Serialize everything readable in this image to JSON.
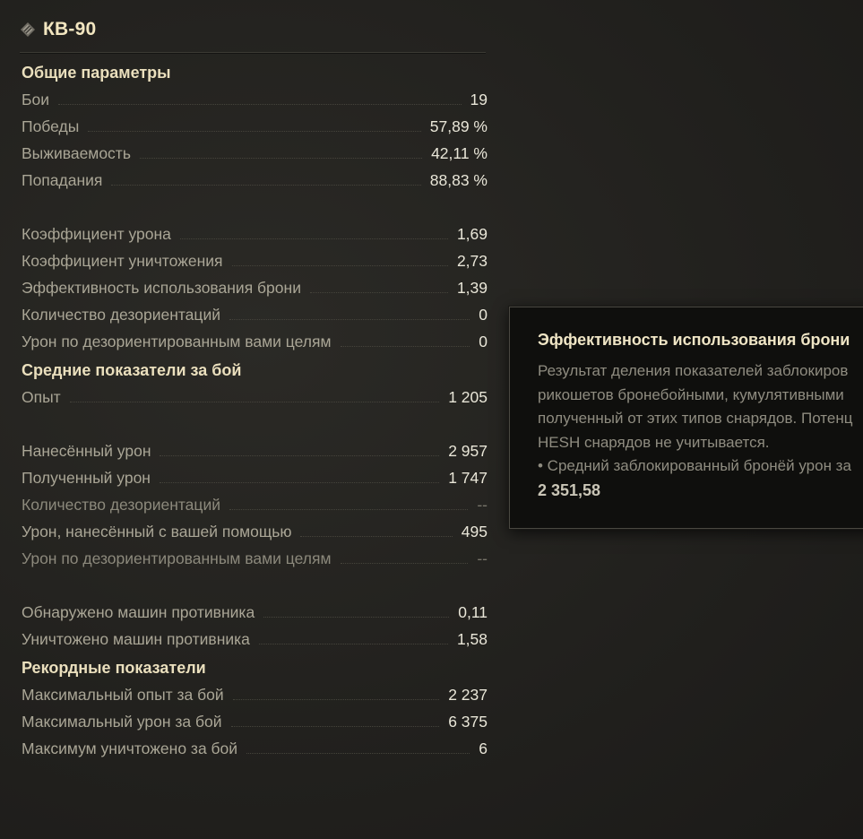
{
  "header": {
    "title": "КВ-90",
    "tier_icon": "heavy-tank-class-icon"
  },
  "sections": [
    {
      "title": "Общие параметры",
      "groups": [
        [
          {
            "label": "Бои",
            "value": "19"
          },
          {
            "label": "Победы",
            "value": "57,89 %"
          },
          {
            "label": "Выживаемость",
            "value": "42,11 %"
          },
          {
            "label": "Попадания",
            "value": "88,83 %"
          }
        ],
        [
          {
            "label": "Коэффициент урона",
            "value": "1,69"
          },
          {
            "label": "Коэффициент уничтожения",
            "value": "2,73"
          },
          {
            "label": "Эффективность использования брони",
            "value": "1,39"
          },
          {
            "label": "Количество дезориентаций",
            "value": "0"
          },
          {
            "label": "Урон по дезориентированным вами целям",
            "value": "0"
          }
        ]
      ]
    },
    {
      "title": "Средние показатели за бой",
      "groups": [
        [
          {
            "label": "Опыт",
            "value": "1 205"
          }
        ],
        [
          {
            "label": "Нанесённый урон",
            "value": "2 957"
          },
          {
            "label": "Полученный урон",
            "value": "1 747"
          },
          {
            "label": "Количество дезориентаций",
            "value": "--",
            "dim": true
          },
          {
            "label": "Урон, нанесённый с вашей помощью",
            "value": "495"
          },
          {
            "label": "Урон по дезориентированным вами целям",
            "value": "--",
            "dim": true
          }
        ],
        [
          {
            "label": "Обнаружено машин противника",
            "value": "0,11"
          },
          {
            "label": "Уничтожено машин противника",
            "value": "1,58"
          }
        ]
      ]
    },
    {
      "title": "Рекордные показатели",
      "groups": [
        [
          {
            "label": "Максимальный опыт за бой",
            "value": "2 237"
          },
          {
            "label": "Максимальный урон за бой",
            "value": "6 375"
          },
          {
            "label": "Максимум уничтожено за бой",
            "value": "6"
          }
        ]
      ]
    }
  ],
  "tooltip": {
    "title": "Эффективность использования брони",
    "lines": [
      "Результат деления показателей заблокиров",
      "рикошетов бронебойными, кумулятивными",
      "полученный от этих типов снарядов. Потенц",
      "HESH снарядов не учитывается.",
      "• Средний заблокированный бронёй урон за"
    ],
    "value": "2 351,58"
  },
  "colors": {
    "title": "#f2e6c0",
    "section_title": "#eadfbd",
    "value": "#e9e6d8",
    "label": "#aaa696"
  }
}
